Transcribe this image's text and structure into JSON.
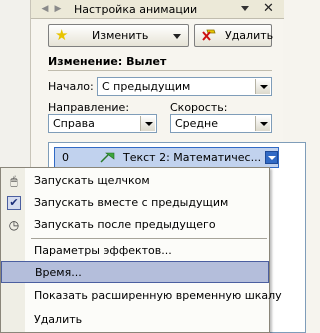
{
  "pane": {
    "title": "Настройка анимации",
    "close_glyph": "✕"
  },
  "toolbar": {
    "change_label": "Изменить",
    "delete_label": "Удалить"
  },
  "section": {
    "title": "Изменение: Вылет"
  },
  "fields": {
    "start_label": "Начало:",
    "start_value": "С предыдущим",
    "direction_label": "Направление:",
    "direction_value": "Справа",
    "speed_label": "Скорость:",
    "speed_value": "Средне"
  },
  "animation_list": {
    "items": [
      {
        "number": "0",
        "text": "Текст 2: Математичес..."
      }
    ]
  },
  "context_menu": {
    "items": [
      {
        "label": "Запускать щелчком",
        "icon": "mouse-icon"
      },
      {
        "label": "Запускать вместе с предыдущим",
        "icon": "check-icon",
        "checked": true
      },
      {
        "label": "Запускать после предыдущего",
        "icon": "clock-icon"
      },
      {
        "label": "Параметры эффектов..."
      },
      {
        "label": "Время...",
        "highlighted": true
      },
      {
        "label": "Показать расширенную временную шкалу"
      },
      {
        "label": "Удалить"
      }
    ]
  },
  "colors": {
    "selection": "#c1d2ee",
    "menu_highlight": "#b4bedb",
    "accent_border": "#316ac5"
  }
}
